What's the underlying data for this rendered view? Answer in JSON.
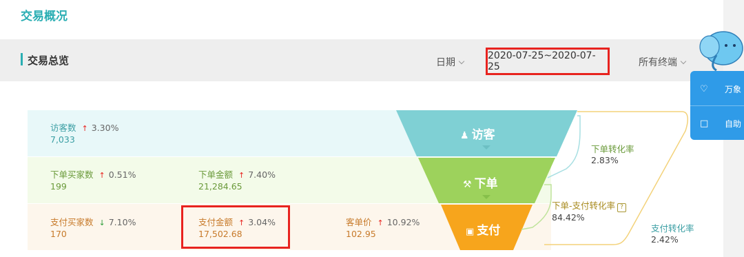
{
  "page": {
    "title": "交易概况"
  },
  "section": {
    "title": "交易总览"
  },
  "filters": {
    "date_label": "日期",
    "date_range": "2020-07-25~2020-07-25",
    "terminal_label": "所有终端"
  },
  "rows": {
    "visitor": {
      "visitors": {
        "label": "访客数",
        "change": "3.30%",
        "direction": "up",
        "value": "7,033"
      }
    },
    "order": {
      "buyers": {
        "label": "下单买家数",
        "change": "0.51%",
        "direction": "up",
        "value": "199"
      },
      "amount": {
        "label": "下单金额",
        "change": "7.40%",
        "direction": "up",
        "value": "21,284.65"
      }
    },
    "pay": {
      "buyers": {
        "label": "支付买家数",
        "change": "7.10%",
        "direction": "down",
        "value": "170"
      },
      "amount": {
        "label": "支付金额",
        "change": "3.04%",
        "direction": "up",
        "value": "17,502.68"
      },
      "unit_price": {
        "label": "客单价",
        "change": "10.92%",
        "direction": "up",
        "value": "102.95"
      }
    }
  },
  "funnel": {
    "visitor_label": "访客",
    "order_label": "下单",
    "pay_label": "支付"
  },
  "conversion": {
    "order_rate": {
      "label": "下单转化率",
      "value": "2.83%"
    },
    "order_pay_rate": {
      "label": "下单-支付转化率",
      "value": "84.42%"
    },
    "pay_rate": {
      "label": "支付转化率",
      "value": "2.42%"
    }
  },
  "popup": {
    "item1": "万象",
    "item2": "自助"
  },
  "icons": {
    "up": "↑",
    "down": "↓",
    "help": "?"
  },
  "colors": {
    "accent": "#2aaeb3",
    "highlight": "#e8231f",
    "funnel_teal": "#7fd0d4",
    "funnel_green": "#9dd25c",
    "funnel_orange": "#f7a51c",
    "popup_blue": "#2f9be8"
  }
}
